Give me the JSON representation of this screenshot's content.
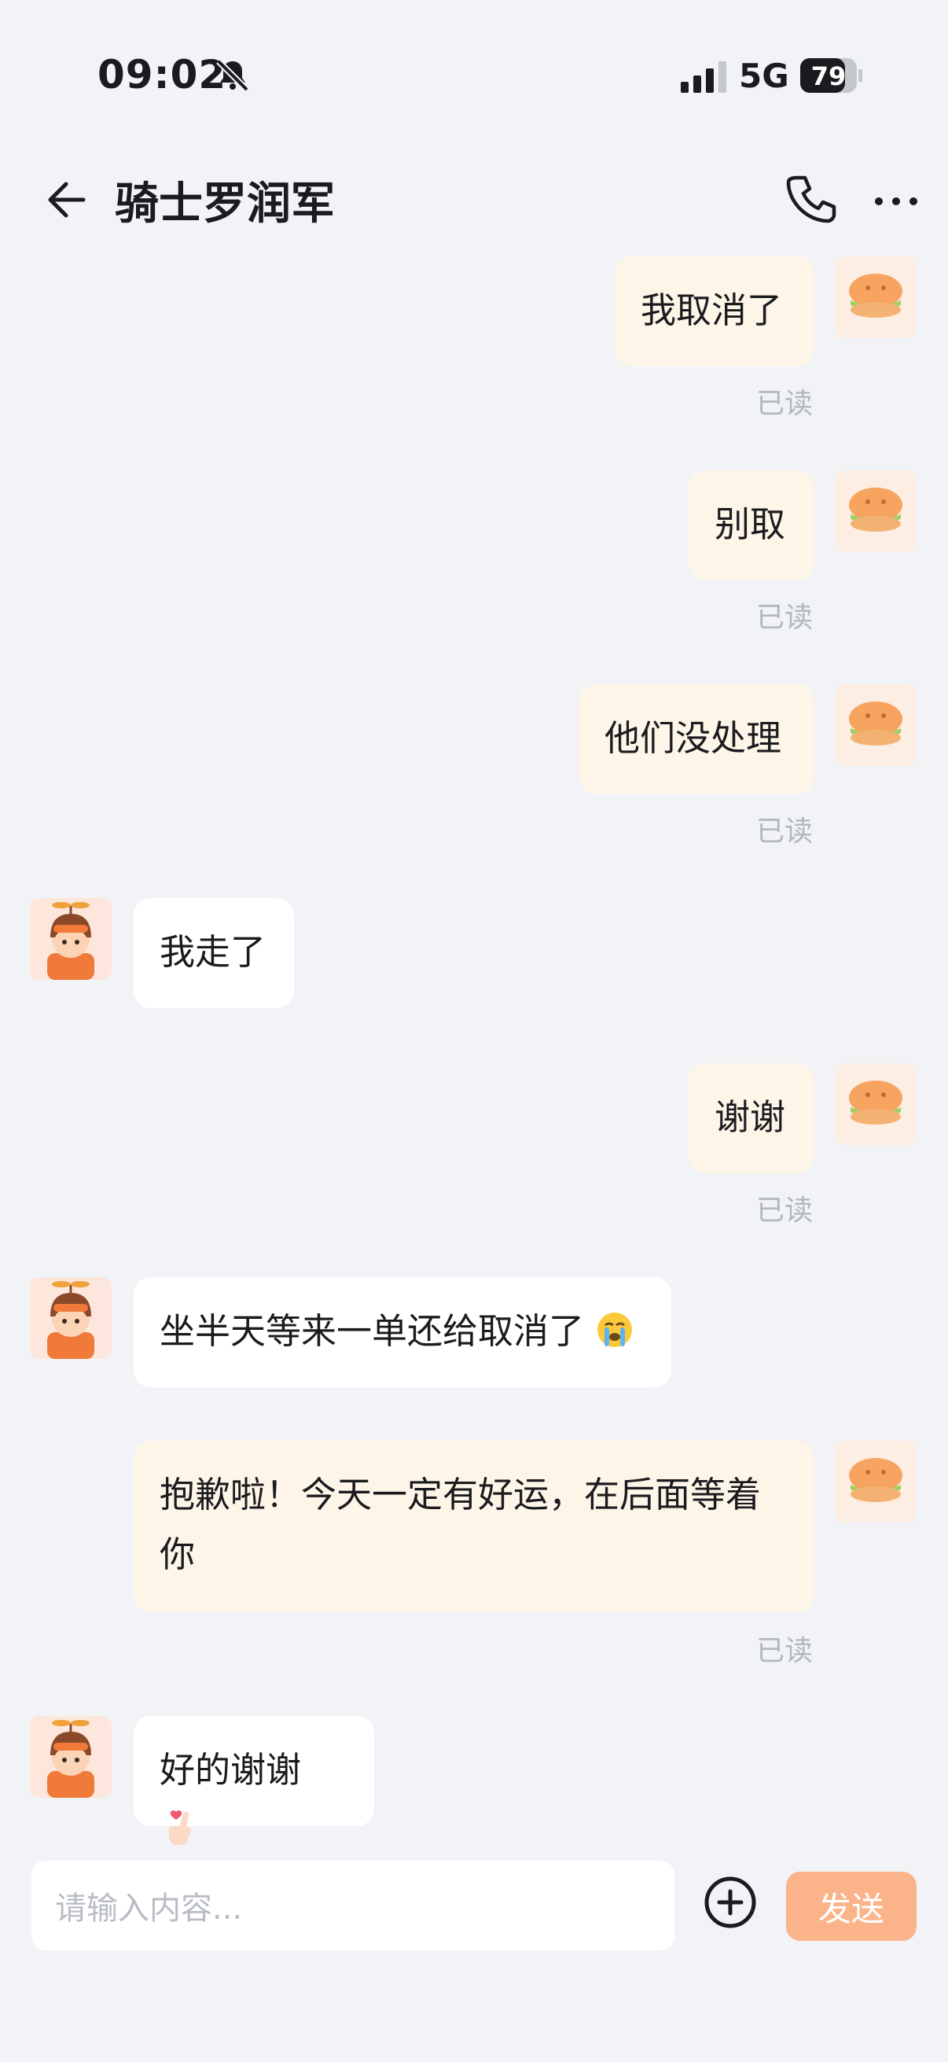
{
  "status_bar": {
    "time": "09:02",
    "network": "5G",
    "battery": "79"
  },
  "header": {
    "title": "骑士罗润军"
  },
  "messages": [
    {
      "from": "me",
      "text": "我取消了",
      "read": "已读"
    },
    {
      "from": "me",
      "text": "别取",
      "read": "已读"
    },
    {
      "from": "me",
      "text": "他们没处理",
      "read": "已读"
    },
    {
      "from": "rider",
      "text": "我走了"
    },
    {
      "from": "me",
      "text": "谢谢",
      "read": "已读"
    },
    {
      "from": "rider",
      "text": "坐半天等来一单还给取消了",
      "emoji": "crying-face-icon"
    },
    {
      "from": "me",
      "text": "抱歉啦！今天一定有好运，在后面等着你",
      "read": "已读"
    },
    {
      "from": "rider",
      "text": "好的谢谢",
      "emoji": "finger-heart-icon"
    }
  ],
  "composer": {
    "placeholder": "请输入内容...",
    "send_label": "发送"
  },
  "colors": {
    "my_bubble": "#fdf6e8",
    "their_bubble": "#ffffff",
    "send_button": "#fbb48a",
    "background": "#f1f3f7"
  }
}
